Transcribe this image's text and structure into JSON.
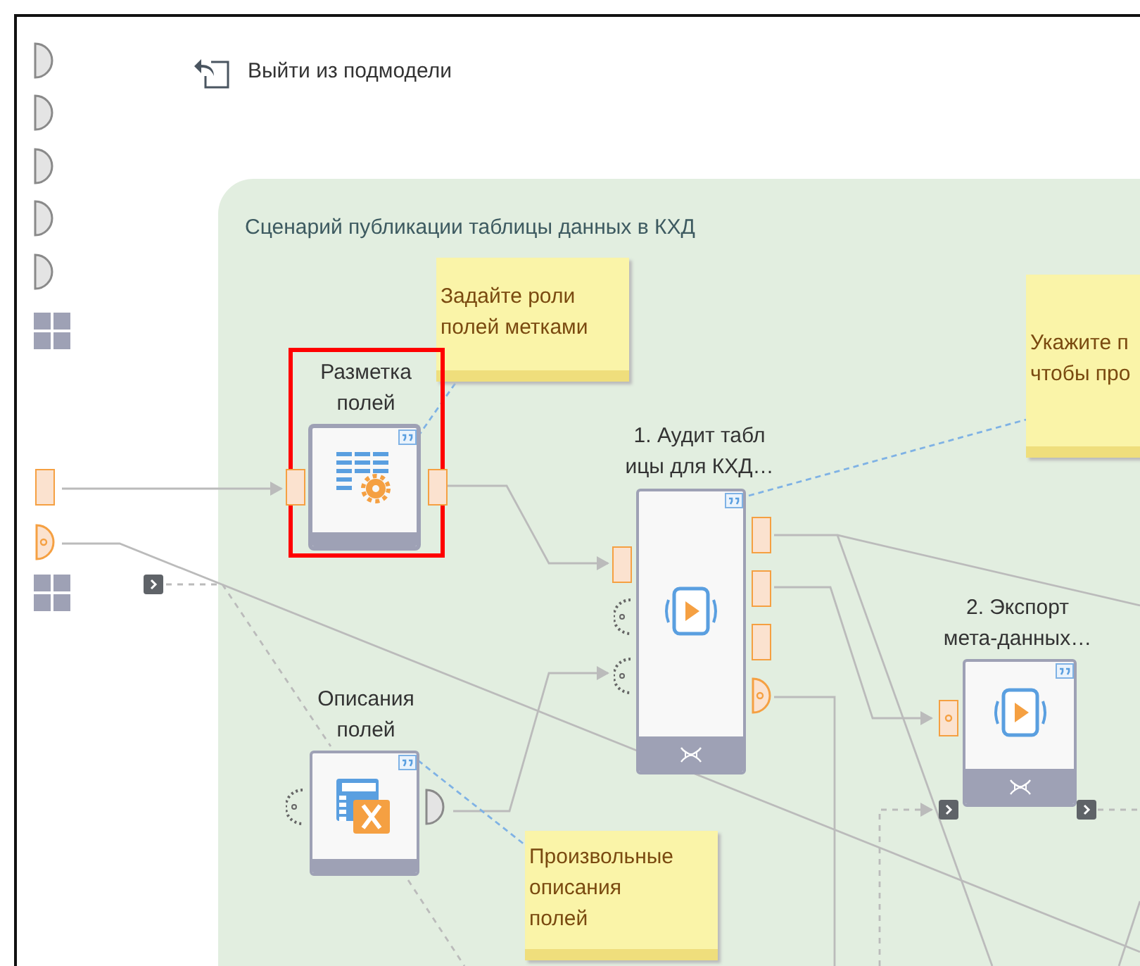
{
  "exit_button": {
    "label": "Выйти из подмодели"
  },
  "group": {
    "title": "Сценарий публикации таблицы данных в КХД"
  },
  "nodes": [
    {
      "label_lines": [
        "Разметка",
        "полей"
      ],
      "kind": "markup",
      "selected": true
    },
    {
      "label_lines": [
        "1. Аудит табл",
        "ицы для КХД…"
      ],
      "kind": "run",
      "selected": false
    },
    {
      "label_lines": [
        "2. Экспорт",
        "мета-данных…"
      ],
      "kind": "run",
      "selected": false
    },
    {
      "label_lines": [
        "Описания",
        "полей"
      ],
      "kind": "formula",
      "selected": false
    }
  ],
  "notes": [
    {
      "lines": [
        "Задайте роли",
        "полей метками"
      ]
    },
    {
      "lines": [
        "Укажите п",
        "чтобы про"
      ]
    },
    {
      "lines": [
        "Произвольные",
        "описания",
        "полей"
      ]
    }
  ]
}
